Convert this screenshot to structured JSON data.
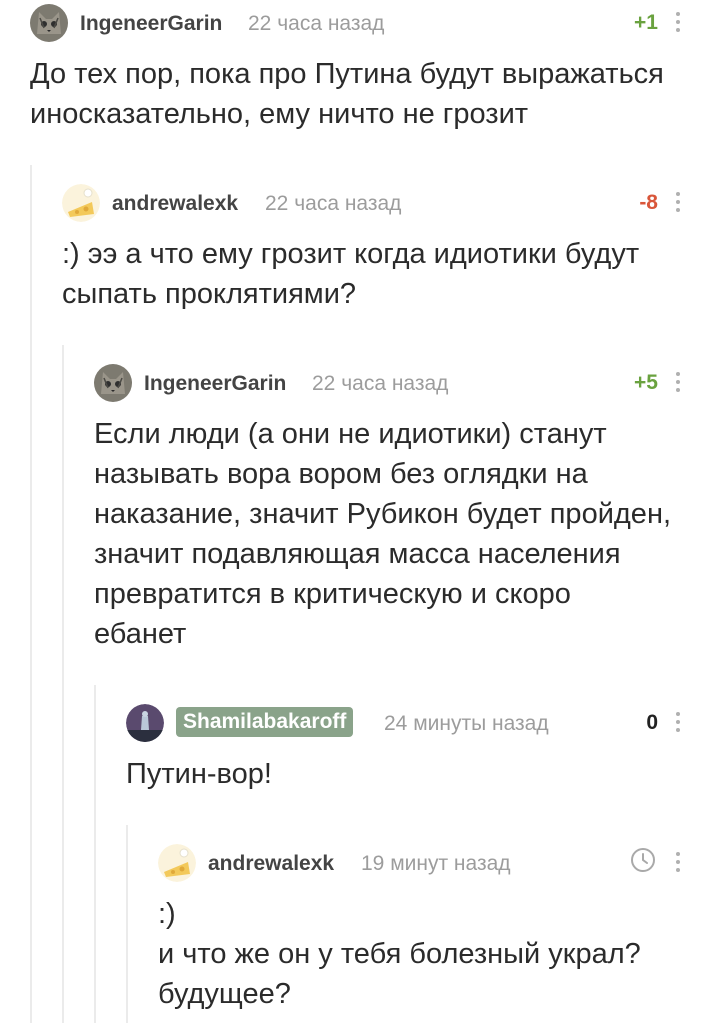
{
  "comments": [
    {
      "user": "IngeneerGarin",
      "time": "22 часа назад",
      "rating": "+1",
      "text": "До тех пор, пока про Путина будут выражаться\nиносказательно, ему ничто не грозит",
      "avatar": "cat-avatar"
    },
    {
      "user": "andrewalexk",
      "time": "22 часа назад",
      "rating": "-8",
      "text": ":) ээ  а что ему грозит когда идиотики будут\nсыпать проклятиями?",
      "avatar": "cheese-avatar"
    },
    {
      "user": "IngeneerGarin",
      "time": "22 часа назад",
      "rating": "+5",
      "text": "Если люди (а они не идиотики) станут\nназывать вора вором без оглядки на\nнаказание, значит Рубикон будет пройден,\nзначит подавляющая масса населения\nпревратится в критическую и скоро\nебанет",
      "avatar": "cat-avatar"
    },
    {
      "user": "Shamilabakaroff",
      "time": "24 минуты назад",
      "rating": "0",
      "text": "Путин-вор!",
      "avatar": "statue-avatar"
    },
    {
      "user": "andrewalexk",
      "time": "19 минут назад",
      "rating": "",
      "text": ":)\nи что же он у тебя болезный украл?\nбудущее?",
      "avatar": "cheese-avatar",
      "status_icon": "clock-icon"
    }
  ],
  "colors": {
    "positive": "#6aa23f",
    "negative": "#d9563a",
    "badge": "#8aa38a",
    "thread_line": "#ebebeb"
  }
}
